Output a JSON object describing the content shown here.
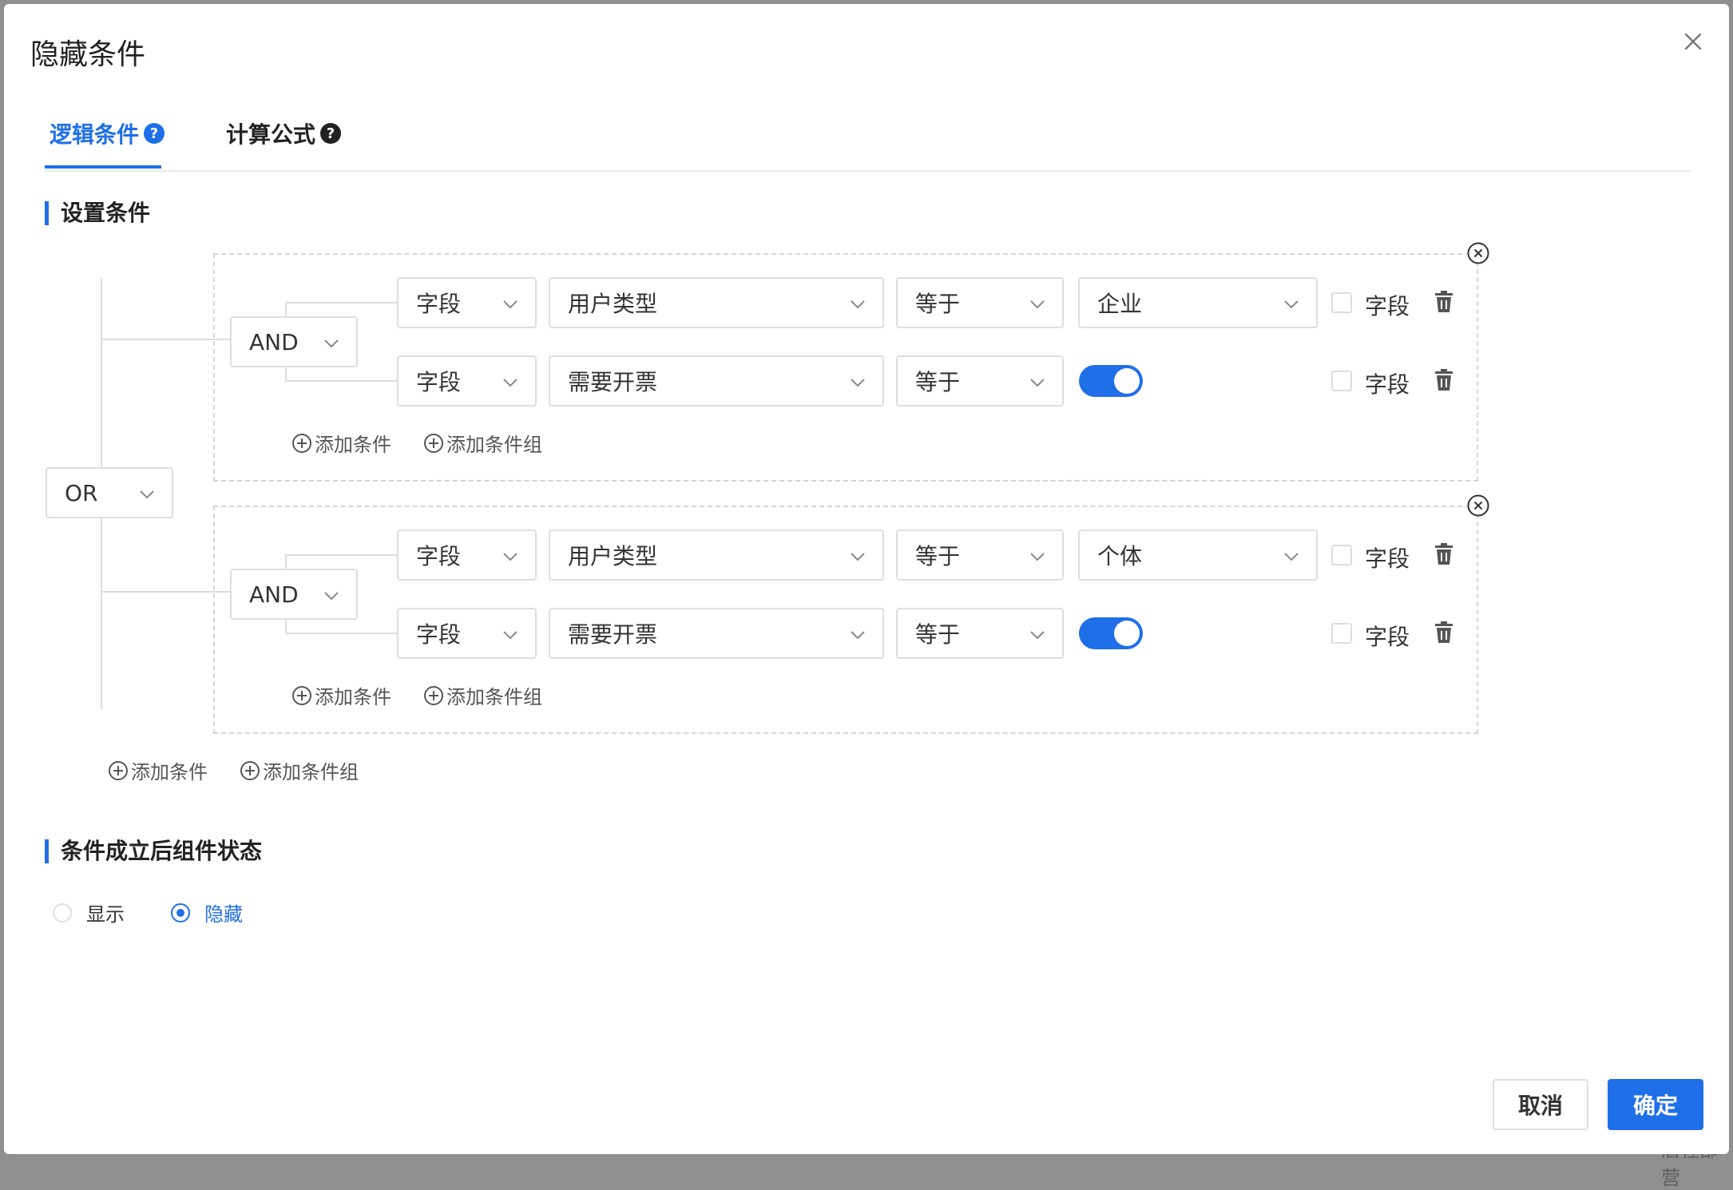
{
  "modal": {
    "title": "隐藏条件"
  },
  "tabs": [
    {
      "label": "逻辑条件",
      "help": "?",
      "active": true
    },
    {
      "label": "计算公式",
      "help": "?",
      "active": false
    }
  ],
  "sections": {
    "set_conditions": "设置条件",
    "state_after": "条件成立后组件状态"
  },
  "root_operator": "OR",
  "groups": [
    {
      "operator": "AND",
      "conditions": [
        {
          "type": "字段",
          "field": "用户类型",
          "op": "等于",
          "value": "企业",
          "value_kind": "select",
          "field_toggle_label": "字段",
          "field_toggle_checked": false
        },
        {
          "type": "字段",
          "field": "需要开票",
          "op": "等于",
          "value_kind": "switch",
          "switch_on": true,
          "field_toggle_label": "字段",
          "field_toggle_checked": false
        }
      ],
      "add_condition": "添加条件",
      "add_group": "添加条件组"
    },
    {
      "operator": "AND",
      "conditions": [
        {
          "type": "字段",
          "field": "用户类型",
          "op": "等于",
          "value": "个体",
          "value_kind": "select",
          "field_toggle_label": "字段",
          "field_toggle_checked": false
        },
        {
          "type": "字段",
          "field": "需要开票",
          "op": "等于",
          "value_kind": "switch",
          "switch_on": true,
          "field_toggle_label": "字段",
          "field_toggle_checked": false
        }
      ],
      "add_condition": "添加条件",
      "add_group": "添加条件组"
    }
  ],
  "root_actions": {
    "add_condition": "添加条件",
    "add_group": "添加条件组"
  },
  "state_options": [
    {
      "label": "显示",
      "checked": false
    },
    {
      "label": "隐藏",
      "checked": true
    }
  ],
  "footer": {
    "cancel": "取消",
    "confirm": "确定"
  },
  "colors": {
    "accent": "#1f6fe8",
    "border": "#dcdee2",
    "dashed": "#d4d6da"
  }
}
